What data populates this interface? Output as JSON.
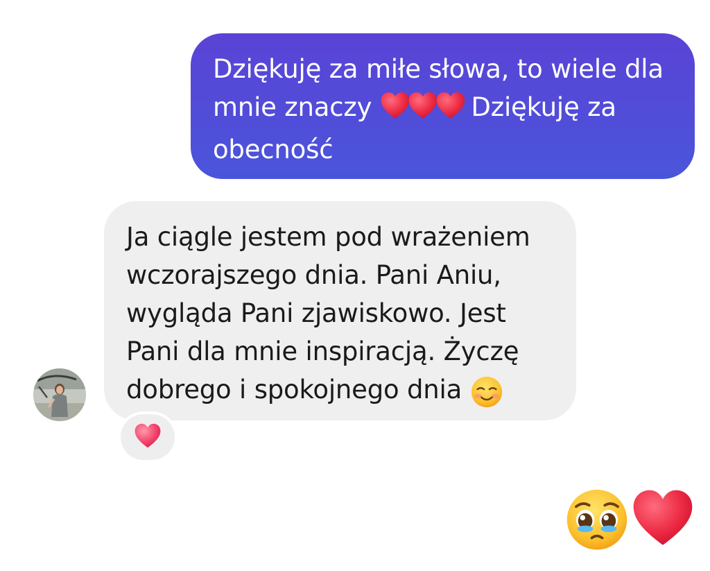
{
  "conversation": {
    "outgoing_message": {
      "line1": "Dziękuję za miłe słowa, to wiele dla",
      "line2_prefix": "mnie znaczy ",
      "line2_suffix": " Dziękuję za",
      "line3": "obecność",
      "emoji_icon": "red-heart-icon"
    },
    "incoming_message": {
      "line1": "Ja ciągle jestem pod wrażeniem",
      "line2": "wczorajszego dnia. Pani Aniu,",
      "line3": "wygląda Pani zjawiskowo. Jest",
      "line4": "Pani dla mnie inspiracją. Życzę",
      "line5": "dobrego i spokojnego dnia ",
      "emoji_icon": "smiling-face-icon",
      "reaction_icon": "pink-heart-icon"
    },
    "outgoing_emojis": [
      "pleading-face-icon",
      "red-heart-icon"
    ]
  },
  "colors": {
    "outgoing_bubble_top": "#5a43d6",
    "outgoing_bubble_bottom": "#4a55db",
    "incoming_bubble": "#efefef",
    "heart_red": "#e8293f"
  }
}
